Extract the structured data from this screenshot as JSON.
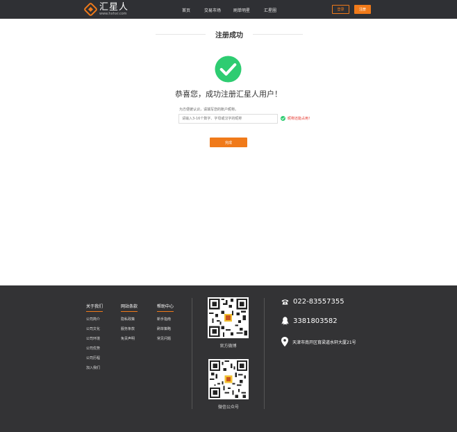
{
  "header": {
    "logo_name": "汇星人",
    "logo_url": "www.hxhxr.com",
    "nav": [
      "首页",
      "交易市场",
      "刷单明星",
      "汇星圈"
    ],
    "login_label": "登录",
    "register_label": "注册"
  },
  "main": {
    "title": "注册成功",
    "congrats": "恭喜您，成功注册汇星人用户！",
    "hint": "为方便彼认识，请填写您的账户昵称。",
    "input_placeholder": "请输入3-16个数字、字母或汉字的昵称",
    "ok_message": "昵称还能占用！",
    "done_label": "完成"
  },
  "footer": {
    "columns": [
      {
        "title": "关于我们",
        "items": [
          "公司简介",
          "公司文化",
          "公司环境",
          "公司优势",
          "公司历程",
          "加入我们"
        ]
      },
      {
        "title": "网站条款",
        "items": [
          "隐私政策",
          "服务条款",
          "免责声明"
        ]
      },
      {
        "title": "帮助中心",
        "items": [
          "新手指南",
          "刷单策略",
          "常见问题"
        ]
      }
    ],
    "qr_weibo_caption": "官方微博",
    "qr_wechat_caption": "微信公众号",
    "phone": "022-83557355",
    "qq": "3381803582",
    "address": "天津市南开区育梁道水轩大厦21号"
  },
  "colors": {
    "accent": "#f07a1a",
    "header_bg": "#2f3034",
    "footer_bg": "#333335",
    "success": "#2ecc71",
    "error": "#e5332a"
  }
}
